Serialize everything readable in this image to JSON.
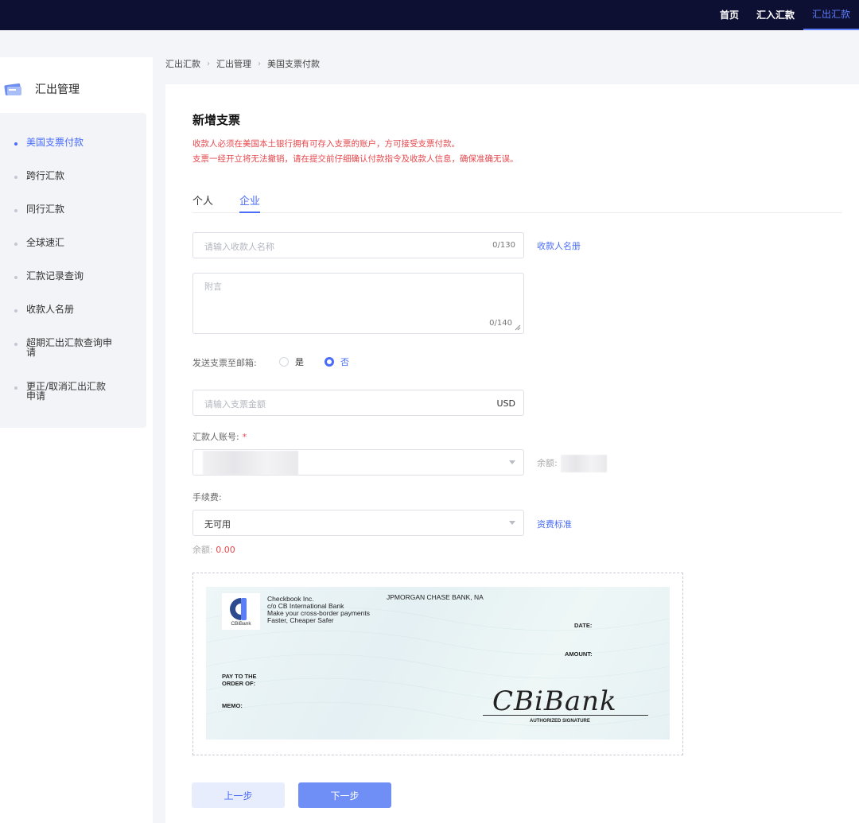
{
  "topnav": {
    "items": [
      "首页",
      "汇入汇款",
      "汇出汇款"
    ],
    "active": "汇出汇款"
  },
  "sidebar": {
    "title": "汇出管理",
    "items": [
      {
        "label": "美国支票付款",
        "active": true
      },
      {
        "label": "跨行汇款"
      },
      {
        "label": "同行汇款"
      },
      {
        "label": "全球速汇"
      },
      {
        "label": "汇款记录查询"
      },
      {
        "label": "收款人名册"
      },
      {
        "label": "超期汇出汇款查询申请"
      },
      {
        "label": "更正/取消汇出汇款申请"
      }
    ]
  },
  "breadcrumb": [
    "汇出汇款",
    "汇出管理",
    "美国支票付款"
  ],
  "page": {
    "title": "新增支票",
    "warnings": [
      "收款人必须在美国本土银行拥有可存入支票的账户，方可接受支票付款。",
      "支票一经开立将无法撤销，请在提交前仔细确认付款指令及收款人信息，确保准确无误。"
    ],
    "tabs": [
      "个人",
      "企业"
    ],
    "active_tab": "企业"
  },
  "form": {
    "payee": {
      "placeholder": "请输入收款人名称",
      "counter": "0/130",
      "link": "收款人名册"
    },
    "memo": {
      "placeholder": "附言",
      "counter": "0/140"
    },
    "send_email": {
      "label": "发送支票至邮箱:",
      "options": [
        "是",
        "否"
      ],
      "selected": "否"
    },
    "amount": {
      "placeholder": "请输入支票金额",
      "currency": "USD"
    },
    "account": {
      "label": "汇款人账号:",
      "required_mark": "*",
      "balance_label": "余额:"
    },
    "fee": {
      "label": "手续费:",
      "value": "无可用",
      "link": "资费标准",
      "balance_label": "余额:",
      "balance_value": "0.00"
    }
  },
  "cheque": {
    "logo_text": "CBiBank",
    "issuer_lines": [
      "Checkbook Inc.",
      "c/o CB International Bank",
      "Make your cross-border payments",
      "Faster, Cheaper Safer"
    ],
    "bank": "JPMORGAN CHASE BANK, NA",
    "date_label": "DATE:",
    "amount_label": "AMOUNT:",
    "pay_to_lines": [
      "PAY TO THE",
      "ORDER OF:"
    ],
    "memo_label": "MEMO:",
    "signature": "CBiBank",
    "signature_caption": "AUTHORIZED SIGNATURE"
  },
  "buttons": {
    "prev": "上一步",
    "next": "下一步"
  },
  "colors": {
    "accent": "#4a6cf7",
    "warning": "#e5484d",
    "topbar": "#0e1033"
  }
}
